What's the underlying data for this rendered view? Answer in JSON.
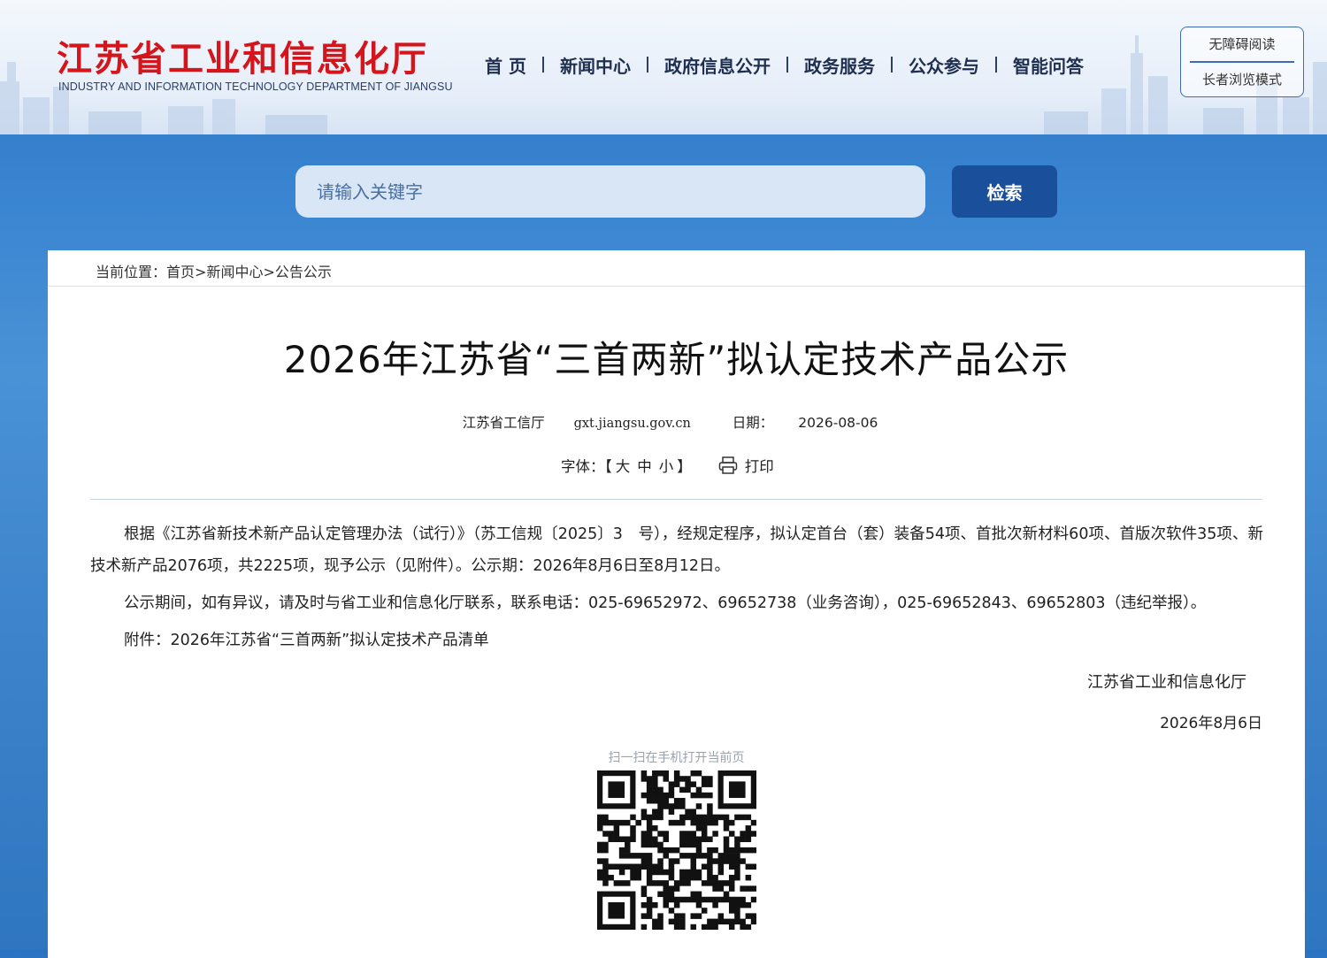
{
  "header": {
    "logo_cn": "江苏省工业和信息化厅",
    "logo_en": "INDUSTRY AND INFORMATION TECHNOLOGY DEPARTMENT OF JIANGSU",
    "nav": [
      {
        "label": "首 页"
      },
      {
        "label": "新闻中心"
      },
      {
        "label": "政府信息公开"
      },
      {
        "label": "政务服务"
      },
      {
        "label": "公众参与"
      },
      {
        "label": "智能问答"
      }
    ],
    "accessibility": {
      "barrier_free": "无障碍阅读",
      "elder_mode": "长者浏览模式"
    }
  },
  "search": {
    "placeholder": "请输入关键字",
    "button_label": "检索"
  },
  "breadcrumb": {
    "prefix": "当前位置：",
    "items": [
      "首页",
      "新闻中心",
      "公告公示"
    ],
    "separator": ">"
  },
  "article": {
    "title": "2026年江苏省“三首两新”拟认定技术产品公示",
    "source": "江苏省工信厅",
    "site": "gxt.jiangsu.gov.cn",
    "date_label": "日期：",
    "date": "2026-08-06",
    "font_label": "字体：【",
    "font_large": "大",
    "font_medium": "中",
    "font_small": "小",
    "font_close": "】",
    "print_label": "打印",
    "paragraphs": [
      "根据《江苏省新技术新产品认定管理办法（试行）》（苏工信规〔2025〕3　号），经规定程序，拟认定首台（套）装备54项、首批次新材料60项、首版次软件35项、新技术新产品2076项，共2225项，现予公示（见附件）。公示期：2026年8月6日至8月12日。",
      "公示期间，如有异议，请及时与省工业和信息化厅联系，联系电话：025-69652972、69652738（业务咨询），025-69652843、69652803（违纪举报）。",
      "附件：2026年江苏省“三首两新”拟认定技术产品清单"
    ],
    "signature_dept": "江苏省工业和信息化厅",
    "signature_date": "2026年8月6日"
  },
  "qr": {
    "label": "扫一扫在手机打开当前页"
  },
  "colors": {
    "logo_red": "#d4161c",
    "search_button": "#1a4f9c",
    "page_blue": "#3b86d2"
  }
}
